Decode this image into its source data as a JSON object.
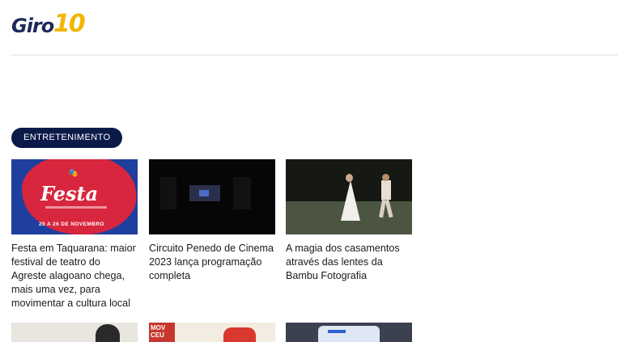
{
  "header": {
    "logo_text": "Giro",
    "logo_number": "10"
  },
  "section": {
    "category_label": "ENTRETENIMENTO"
  },
  "articles": [
    {
      "title": "Festa em Taquarana: maior festival de teatro do Agreste alagoano chega, mais uma vez, para movimentar a cultura local",
      "thumb": {
        "poster_title": "Festa",
        "poster_subtitle": "FESTIVAL DE TEATRO DE TAQUARANA",
        "poster_dates": "20 A 26 DE NOVEMBRO"
      }
    },
    {
      "title": "Circuito Penedo de Cinema 2023 lança programação completa"
    },
    {
      "title": "A magia dos casamentos através das lentes da Bambu Fotografia"
    }
  ],
  "next_row": {
    "poster_text": "MOV CEU"
  },
  "colors": {
    "brand_navy": "#0c1a4a",
    "brand_yellow": "#f2b705",
    "text": "#1a1a1a"
  }
}
